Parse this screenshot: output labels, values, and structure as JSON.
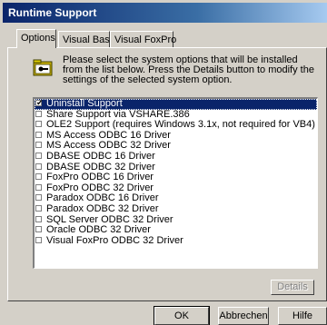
{
  "window": {
    "title": "Runtime Support"
  },
  "tabs": [
    {
      "label": "Options",
      "active": true
    },
    {
      "label": "Visual Basic",
      "active": false
    },
    {
      "label": "Visual FoxPro",
      "active": false
    }
  ],
  "instructions": "Please select the system options that will be installed from the list below. Press the Details button to modify the settings of the selected system option.",
  "options": [
    {
      "label": "Uninstall Support",
      "checked": true,
      "selected": true
    },
    {
      "label": "Share Support via VSHARE.386",
      "checked": false
    },
    {
      "label": "OLE2 Support (requires Windows 3.1x, not required for VB4)",
      "checked": false
    },
    {
      "label": "MS Access ODBC 16 Driver",
      "checked": false
    },
    {
      "label": "MS Access ODBC 32 Driver",
      "checked": false
    },
    {
      "label": "DBASE ODBC 16 Driver",
      "checked": false
    },
    {
      "label": "DBASE ODBC 32 Driver",
      "checked": false
    },
    {
      "label": "FoxPro ODBC 16 Driver",
      "checked": false
    },
    {
      "label": "FoxPro ODBC 32 Driver",
      "checked": false
    },
    {
      "label": "Paradox ODBC 16 Driver",
      "checked": false
    },
    {
      "label": "Paradox ODBC 32 Driver",
      "checked": false
    },
    {
      "label": "SQL Server ODBC 32 Driver",
      "checked": false
    },
    {
      "label": "Oracle ODBC 32 Driver",
      "checked": false
    },
    {
      "label": "Visual FoxPro ODBC 32 Driver",
      "checked": false
    }
  ],
  "details_label": "Details",
  "buttons": {
    "ok": "OK",
    "cancel": "Abbrechen",
    "help": "Hilfe"
  },
  "icons": {
    "info": "folder-key-icon",
    "check": "checkmark-icon"
  },
  "colors": {
    "title_start": "#0a246a",
    "selection": "#0a246a",
    "face": "#d4d0c8"
  }
}
